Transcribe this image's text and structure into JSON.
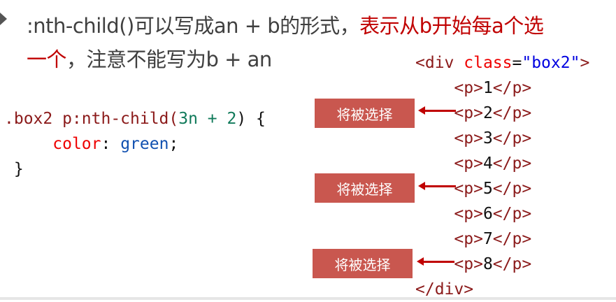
{
  "slide": {
    "line1_black": ":nth-child()可以写成an + b的形式，",
    "line1_red": "表示从b开始每a个选",
    "line2_red": "一个",
    "line2_black": "，注意不能写为b + an"
  },
  "css_code": {
    "selector": ".box2 p:nth-child(",
    "arg_a": "3n",
    "arg_rest": " + 2",
    "open": ") {",
    "property": "color",
    "colon": ": ",
    "value": "green",
    "semicolon": ";",
    "close": "}"
  },
  "html_code": {
    "open_tag": "<div ",
    "attr": "class",
    "eq": "=",
    "attr_value": "\"box2\"",
    "gt": ">",
    "items": [
      "1",
      "2",
      "3",
      "4",
      "5",
      "6",
      "7",
      "8"
    ],
    "p_open": "<p>",
    "p_close": "</p>",
    "close_tag": "</div>"
  },
  "labels": [
    "将被选择",
    "将被选择",
    "将被选择"
  ],
  "colors": {
    "accent_red": "#c00000",
    "label_bg": "#c9574f"
  }
}
